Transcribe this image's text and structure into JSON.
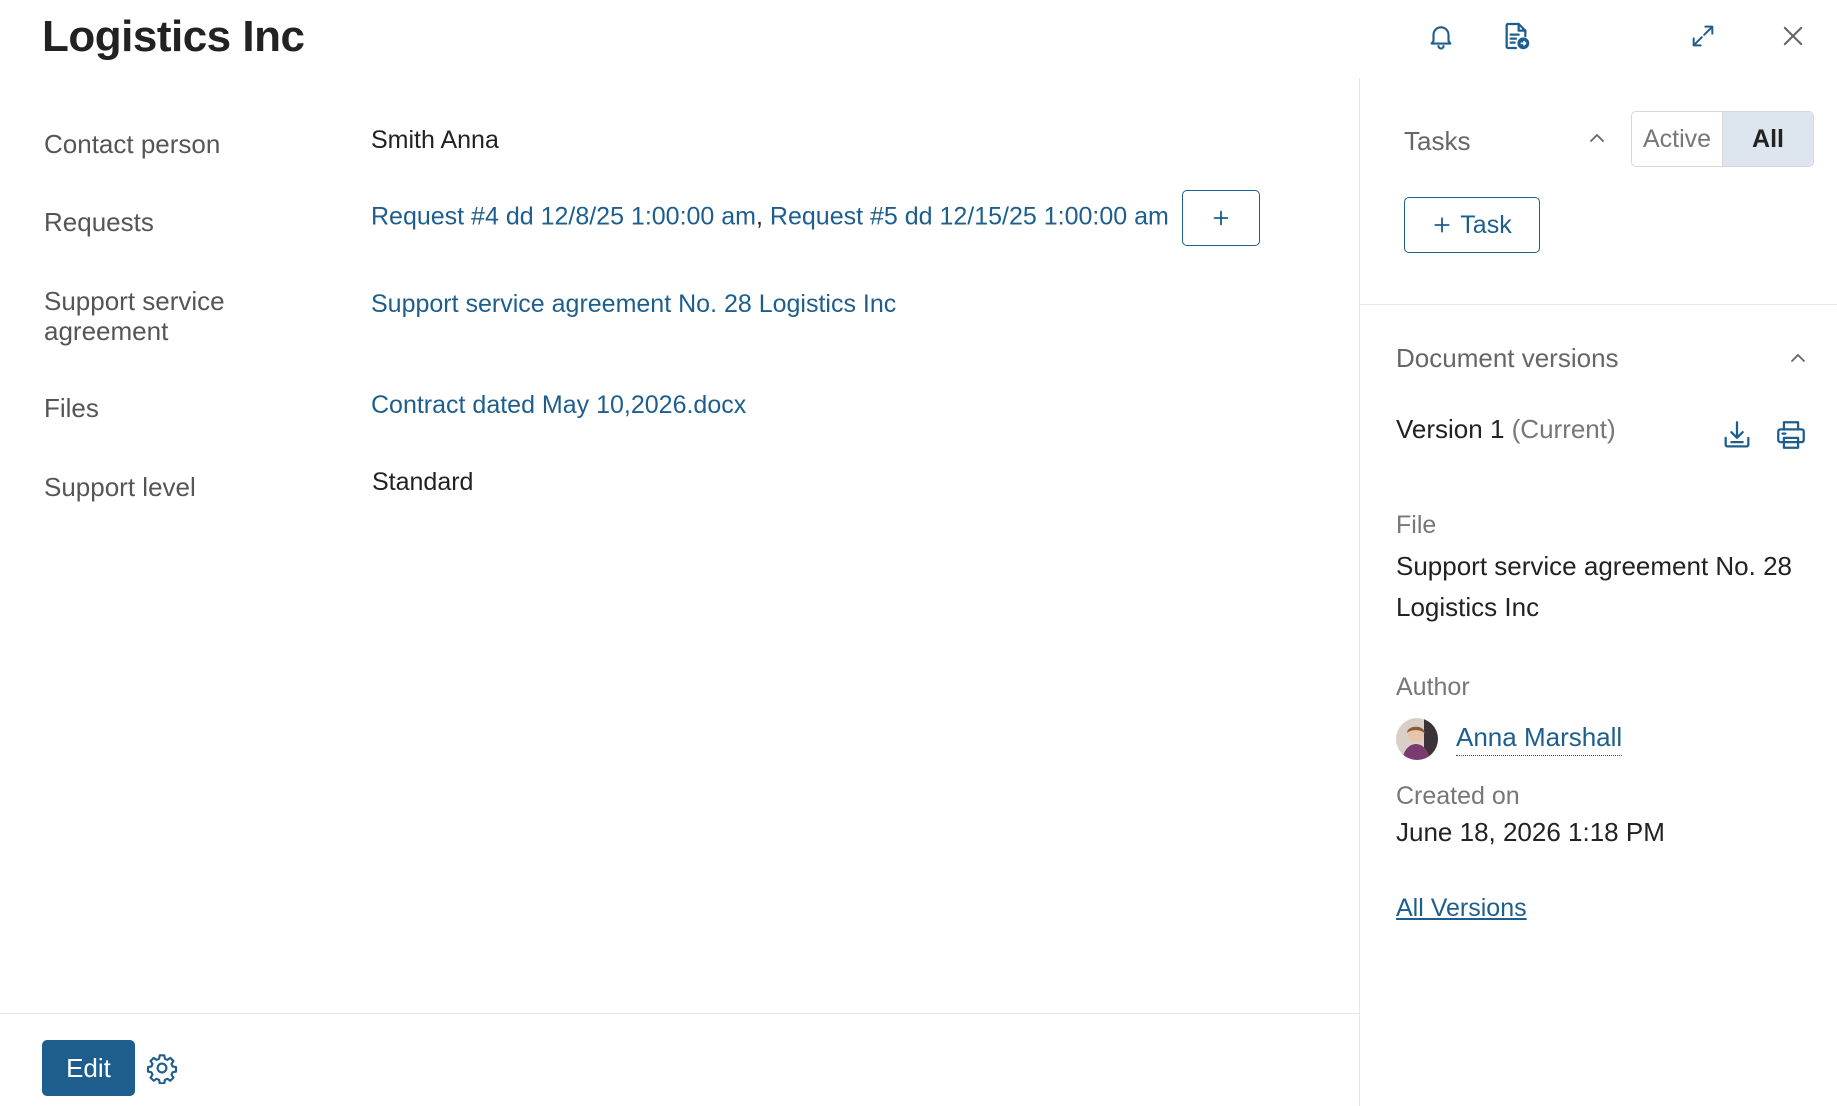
{
  "header": {
    "title": "Logistics Inc",
    "icons": [
      "bell-icon",
      "document-share-icon",
      "expand-icon",
      "close-icon"
    ]
  },
  "fields": {
    "contact_person": {
      "label": "Contact person",
      "value": "Smith Anna"
    },
    "requests": {
      "label": "Requests",
      "items": [
        "Request #4 dd 12/8/25 1:00:00 am",
        "Request #5 dd 12/15/25 1:00:00 am"
      ],
      "separator": ","
    },
    "agreement": {
      "label": "Support service agreement",
      "value": "Support service agreement No. 28 Logistics Inc"
    },
    "files": {
      "label": "Files",
      "value": "Contract dated May 10,2026.docx"
    },
    "support_level": {
      "label": "Support level",
      "value": "Standard"
    }
  },
  "footer": {
    "edit_label": "Edit"
  },
  "sidebar": {
    "tasks": {
      "heading": "Tasks",
      "filter_active": "Active",
      "filter_all": "All",
      "selected_filter": "All",
      "add_task_label": "Task"
    },
    "document_versions": {
      "heading": "Document versions",
      "version_label": "Version 1",
      "version_status": "(Current)",
      "file_label": "File",
      "file_value": "Support service agreement No. 28 Logistics Inc",
      "author_label": "Author",
      "author_name": "Anna Marshall",
      "created_label": "Created on",
      "created_value": "June 18, 2026 1:18 PM",
      "all_versions_link": "All Versions"
    }
  },
  "colors": {
    "accent": "#1e5e8e",
    "label_text": "#555555",
    "border": "#e6e6e6",
    "toggle_selected_bg": "#dde6ee"
  }
}
